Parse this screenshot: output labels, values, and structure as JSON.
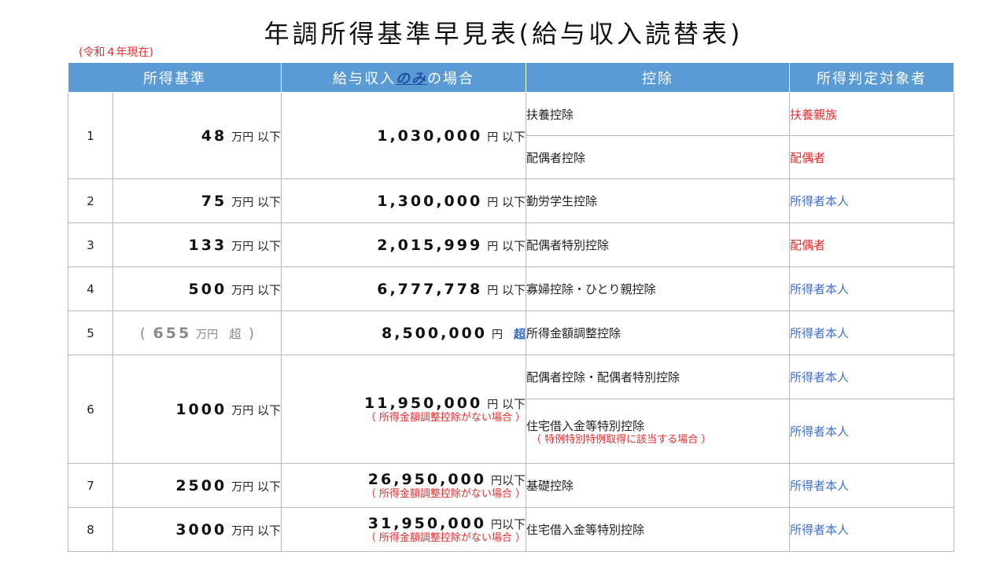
{
  "title": "年調所得基準早見表(給与収入読替表)",
  "era": "(令和４年現在)",
  "headers": {
    "h1": "所得基準",
    "h2_pre": "給与収入",
    "h2_em": "のみ",
    "h2_post": "の場合",
    "h3": "控除",
    "h4": "所得判定対象者"
  },
  "units": {
    "man": "万円",
    "yen": "円",
    "ika": "以下",
    "cho": "超"
  },
  "notes": {
    "salary": "（ 所得金額調整控除がない場合 ）",
    "deduction": "（ 特例特別特例取得に該当する場合 ）"
  },
  "rows": [
    {
      "no": "1",
      "threshold": "48",
      "salary": "1,030,000",
      "deductions": [
        {
          "label": "扶養控除",
          "target": "扶養親族",
          "target_color": "#e53030"
        },
        {
          "label": "配偶者控除",
          "target": "配偶者",
          "target_color": "#e53030"
        }
      ]
    },
    {
      "no": "2",
      "threshold": "75",
      "salary": "1,300,000",
      "deductions": [
        {
          "label": "勤労学生控除",
          "target": "所得者本人",
          "target_color": "#4472c4"
        }
      ]
    },
    {
      "no": "3",
      "threshold": "133",
      "salary": "2,015,999",
      "deductions": [
        {
          "label": "配偶者特別控除",
          "target": "配偶者",
          "target_color": "#e53030"
        }
      ]
    },
    {
      "no": "4",
      "threshold": "500",
      "salary": "6,777,778",
      "deductions": [
        {
          "label": "寡婦控除・ひとり親控除",
          "target": "所得者本人",
          "target_color": "#4472c4"
        }
      ]
    },
    {
      "no": "5",
      "threshold": "655",
      "threshold_suffix": "超",
      "salary": "8,500,000",
      "salary_suffix": "超",
      "deductions": [
        {
          "label": "所得金額調整控除",
          "target": "所得者本人",
          "target_color": "#4472c4"
        }
      ]
    },
    {
      "no": "6",
      "threshold": "1000",
      "salary": "11,950,000",
      "deductions": [
        {
          "label": "配偶者控除・配偶者特別控除",
          "target": "所得者本人",
          "target_color": "#4472c4"
        },
        {
          "label": "住宅借入金等特別控除",
          "target": "所得者本人",
          "target_color": "#4472c4"
        }
      ]
    },
    {
      "no": "7",
      "threshold": "2500",
      "salary": "26,950,000",
      "deductions": [
        {
          "label": "基礎控除",
          "target": "所得者本人",
          "target_color": "#4472c4"
        }
      ]
    },
    {
      "no": "8",
      "threshold": "3000",
      "salary": "31,950,000",
      "deductions": [
        {
          "label": "住宅借入金等特別控除",
          "target": "所得者本人",
          "target_color": "#4472c4"
        }
      ]
    }
  ]
}
